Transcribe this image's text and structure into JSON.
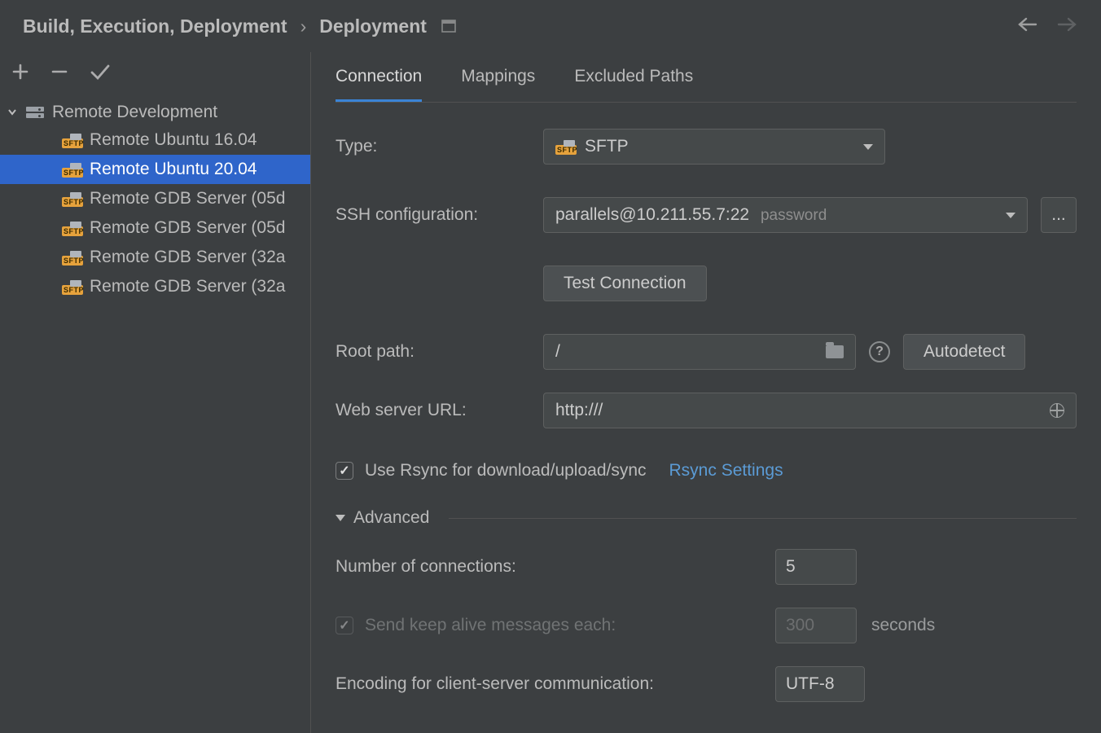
{
  "breadcrumb": {
    "segment1": "Build, Execution, Deployment",
    "segment2": "Deployment"
  },
  "tree": {
    "root_label": "Remote Development",
    "items": [
      {
        "label": "Remote Ubuntu 16.04",
        "selected": false
      },
      {
        "label": "Remote Ubuntu 20.04",
        "selected": true
      },
      {
        "label": "Remote GDB Server (05d",
        "selected": false
      },
      {
        "label": "Remote GDB Server (05d",
        "selected": false
      },
      {
        "label": "Remote GDB Server (32a",
        "selected": false
      },
      {
        "label": "Remote GDB Server (32a",
        "selected": false
      }
    ]
  },
  "tabs": {
    "connection": "Connection",
    "mappings": "Mappings",
    "excluded": "Excluded Paths"
  },
  "form": {
    "type_label": "Type:",
    "type_value": "SFTP",
    "ssh_label": "SSH configuration:",
    "ssh_value": "parallels@10.211.55.7:22",
    "ssh_hint": "password",
    "ssh_more": "...",
    "test_connection": "Test Connection",
    "root_label": "Root path:",
    "root_value": "/",
    "autodetect": "Autodetect",
    "web_label": "Web server URL:",
    "web_value": "http:///",
    "rsync_label": "Use Rsync for download/upload/sync",
    "rsync_settings": "Rsync Settings",
    "advanced": "Advanced",
    "num_conn_label": "Number of connections:",
    "num_conn_value": "5",
    "keepalive_label": "Send keep alive messages each:",
    "keepalive_value": "300",
    "keepalive_unit": "seconds",
    "encoding_label": "Encoding for client-server communication:",
    "encoding_value": "UTF-8",
    "sftp_badge": "SFTP"
  }
}
